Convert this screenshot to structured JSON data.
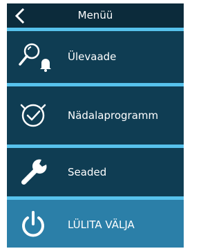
{
  "header": {
    "title": "Menüü",
    "back_icon": "chevron-left-icon"
  },
  "menu": {
    "items": [
      {
        "label": "Ülevaade",
        "icon": "search-bell-icon"
      },
      {
        "label": "Nädalaprogramm",
        "icon": "clock-check-icon"
      },
      {
        "label": "Seaded",
        "icon": "wrench-icon"
      },
      {
        "label": "LÜLITA VÄLJA",
        "icon": "power-icon"
      }
    ]
  },
  "colors": {
    "header_bg": "#0c2b3b",
    "item_bg": "#0f3d53",
    "power_bg": "#2b7fa8",
    "separator": "#57c2ec",
    "text": "#ffffff"
  }
}
